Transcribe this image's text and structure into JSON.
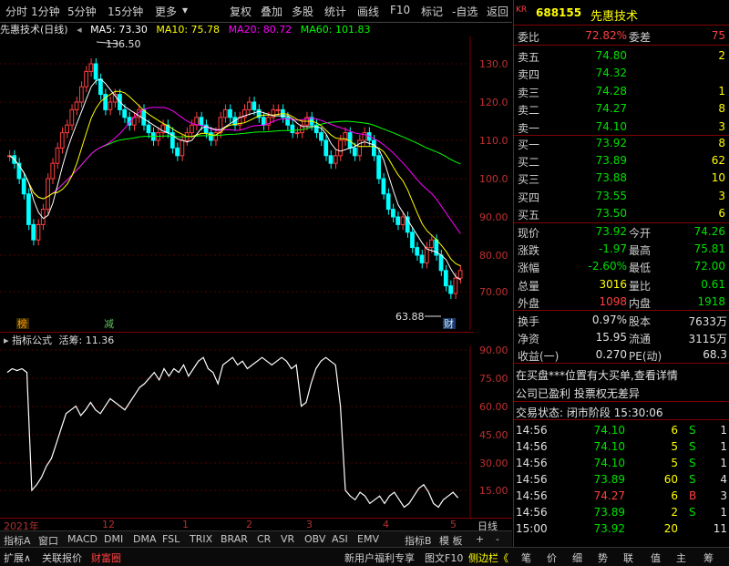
{
  "toolbar": {
    "left_items": [
      "分时",
      "1分钟",
      "5分钟",
      "15分钟",
      "更多"
    ],
    "right_items": [
      "复权",
      "叠加",
      "多股",
      "统计",
      "画线",
      "F10",
      "标记",
      "-自选",
      "返回"
    ]
  },
  "chart_title": {
    "name": "先惠技术(日线)",
    "ma5": "MA5: 73.30",
    "ma10": "MA10: 75.78",
    "ma20": "MA20: 80.72",
    "ma60": "MA60: 101.83"
  },
  "colors": {
    "ma5": "#ffffff",
    "ma10": "#ffff00",
    "ma20": "#ff00ff",
    "ma60": "#00ff00",
    "up": "#ff4040",
    "down": "#00ffff",
    "grid": "#800000"
  },
  "price_axis": [
    "130.0",
    "120.0",
    "110.0",
    "100.0",
    "90.00",
    "80.00",
    "70.00"
  ],
  "annotations": {
    "high": "136.50",
    "low": "63.88",
    "badge_left": "榜",
    "badge_mid": "减",
    "badge_right": "财"
  },
  "indicator": {
    "name": "指标公式",
    "label": "活筹: 11.36",
    "axis": [
      "90.00",
      "75.00",
      "60.00",
      "45.00",
      "30.00",
      "15.00"
    ]
  },
  "date_axis": {
    "labels": [
      "2021年",
      "12",
      "1",
      "2",
      "3",
      "4",
      "5"
    ],
    "period": "日线"
  },
  "tabs": [
    "指标A",
    "窗口",
    "MACD",
    "DMI",
    "DMA",
    "FSL",
    "TRIX",
    "BRAR",
    "CR",
    "VR",
    "OBV",
    "ASI",
    "EMV",
    "指标B",
    "模 板",
    "+",
    "-"
  ],
  "bottombar": {
    "left": [
      "扩展∧",
      "关联报价",
      "财富圈"
    ],
    "middle": "新用户福利专享",
    "right_items": [
      "图文F10",
      "侧边栏《"
    ],
    "panel_tabs": [
      "笔",
      "价",
      "细",
      "势",
      "联",
      "值",
      "主",
      "筹"
    ]
  },
  "quote": {
    "market": "KR",
    "code": "688155",
    "name": "先惠技术",
    "weibi_label": "委比",
    "weibi": "72.82%",
    "weicha_label": "委差",
    "weicha": "75",
    "sell": [
      {
        "label": "卖五",
        "price": "74.80",
        "vol": "2"
      },
      {
        "label": "卖四",
        "price": "74.32",
        "vol": ""
      },
      {
        "label": "卖三",
        "price": "74.28",
        "vol": "1"
      },
      {
        "label": "卖二",
        "price": "74.27",
        "vol": "8"
      },
      {
        "label": "卖一",
        "price": "74.10",
        "vol": "3"
      }
    ],
    "buy": [
      {
        "label": "买一",
        "price": "73.92",
        "vol": "8"
      },
      {
        "label": "买二",
        "price": "73.89",
        "vol": "62"
      },
      {
        "label": "买三",
        "price": "73.88",
        "vol": "10"
      },
      {
        "label": "买四",
        "price": "73.55",
        "vol": "3"
      },
      {
        "label": "买五",
        "price": "73.50",
        "vol": "6"
      }
    ],
    "stats": [
      {
        "l1": "现价",
        "v1": "73.92",
        "l2": "今开",
        "v2": "74.26"
      },
      {
        "l1": "涨跌",
        "v1": "-1.97",
        "l2": "最高",
        "v2": "75.81"
      },
      {
        "l1": "涨幅",
        "v1": "-2.60%",
        "l2": "最低",
        "v2": "72.00"
      },
      {
        "l1": "总量",
        "v1": "3016",
        "l2": "量比",
        "v2": "0.61"
      },
      {
        "l1": "外盘",
        "v1": "1098",
        "l2": "内盘",
        "v2": "1918"
      }
    ],
    "finance": [
      {
        "l1": "换手",
        "v1": "0.97%",
        "l2": "股本",
        "v2": "7633万"
      },
      {
        "l1": "净资",
        "v1": "15.95",
        "l2": "流通",
        "v2": "3115万"
      },
      {
        "l1": "收益(一)",
        "v1": "0.270",
        "l2": "PE(动)",
        "v2": "68.3"
      }
    ],
    "news1": "在买盘***位置有大买单,查看详情",
    "news2": "公司已盈利 投票权无差异",
    "trade_status": "交易状态: 闭市阶段 15:30:06",
    "ticks": [
      {
        "t": "14:56",
        "p": "74.10",
        "v": "6",
        "s": "S",
        "n": "1"
      },
      {
        "t": "14:56",
        "p": "74.10",
        "v": "5",
        "s": "S",
        "n": "1"
      },
      {
        "t": "14:56",
        "p": "74.10",
        "v": "5",
        "s": "S",
        "n": "1"
      },
      {
        "t": "14:56",
        "p": "73.89",
        "v": "60",
        "s": "S",
        "n": "4"
      },
      {
        "t": "14:56",
        "p": "74.27",
        "v": "6",
        "s": "B",
        "n": "3"
      },
      {
        "t": "14:56",
        "p": "73.89",
        "v": "2",
        "s": "S",
        "n": "1"
      },
      {
        "t": "15:00",
        "p": "73.92",
        "v": "20",
        "s": "",
        "n": "11"
      }
    ]
  }
}
